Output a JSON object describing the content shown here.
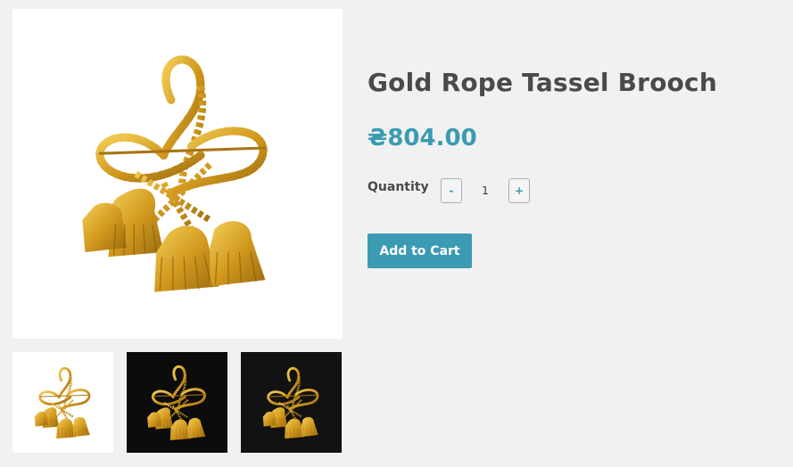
{
  "product": {
    "title": "Gold Rope Tassel Brooch",
    "price": "₴804.00",
    "quantity_label": "Quantity",
    "quantity_value": "1",
    "minus_label": "-",
    "plus_label": "+",
    "add_to_cart_label": "Add to Cart"
  },
  "gallery": {
    "thumbnail_count": 3,
    "thumbnail_backgrounds": [
      "#ffffff",
      "#0c0c0c",
      "#121212"
    ]
  },
  "colors": {
    "accent": "#3a9bb2",
    "text": "#4a4a4a",
    "page_background": "#f1f1f1",
    "gold": "#d8a429"
  }
}
